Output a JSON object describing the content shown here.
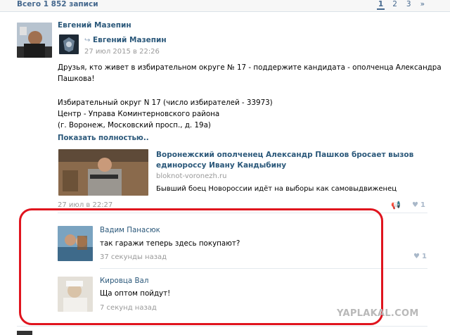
{
  "header": {
    "records_count": "Всего 1 852 записи",
    "pages": [
      "1",
      "2",
      "3",
      "»"
    ]
  },
  "post": {
    "author": "Евгений Мазепин",
    "repost_author": "Евгений Мазепин",
    "repost_date": "27 июл 2015 в 22:26",
    "text_lines": [
      "Друзья, кто живет в избирательном округе № 17 - поддержите кандидата - ополченца Александра",
      "Пашкова!",
      "",
      "Избирательный округ N 17 (число избирателей - 33973)",
      "Центр - Управа Коминтерновского района",
      "(г. Воронеж, Московский просп., д. 19а)"
    ],
    "show_more": "Показать полностью..",
    "link": {
      "title_line1": "Воронежский ополченец Александр Пашков бросает вызов",
      "title_line2": "единороссу Ивану Кандыбину",
      "domain": "bloknot-voronezh.ru",
      "description": "Бывший боец Новороссии идёт на выборы как самовыдвиженец"
    },
    "date": "27 июл в 22:27",
    "likes": "1"
  },
  "comments": [
    {
      "name": "Вадим Панасюк",
      "text": "так гаражи теперь здесь покупают?",
      "date": "37 секунды назад",
      "likes": "1"
    },
    {
      "name": "Кировца Вал",
      "text": "Ща оптом пойдут!",
      "date": "7 секунд назад"
    }
  ],
  "watermark": "YAPLAKAL.COM",
  "colors": {
    "link": "#2b587a",
    "highlight": "#e0141e"
  }
}
